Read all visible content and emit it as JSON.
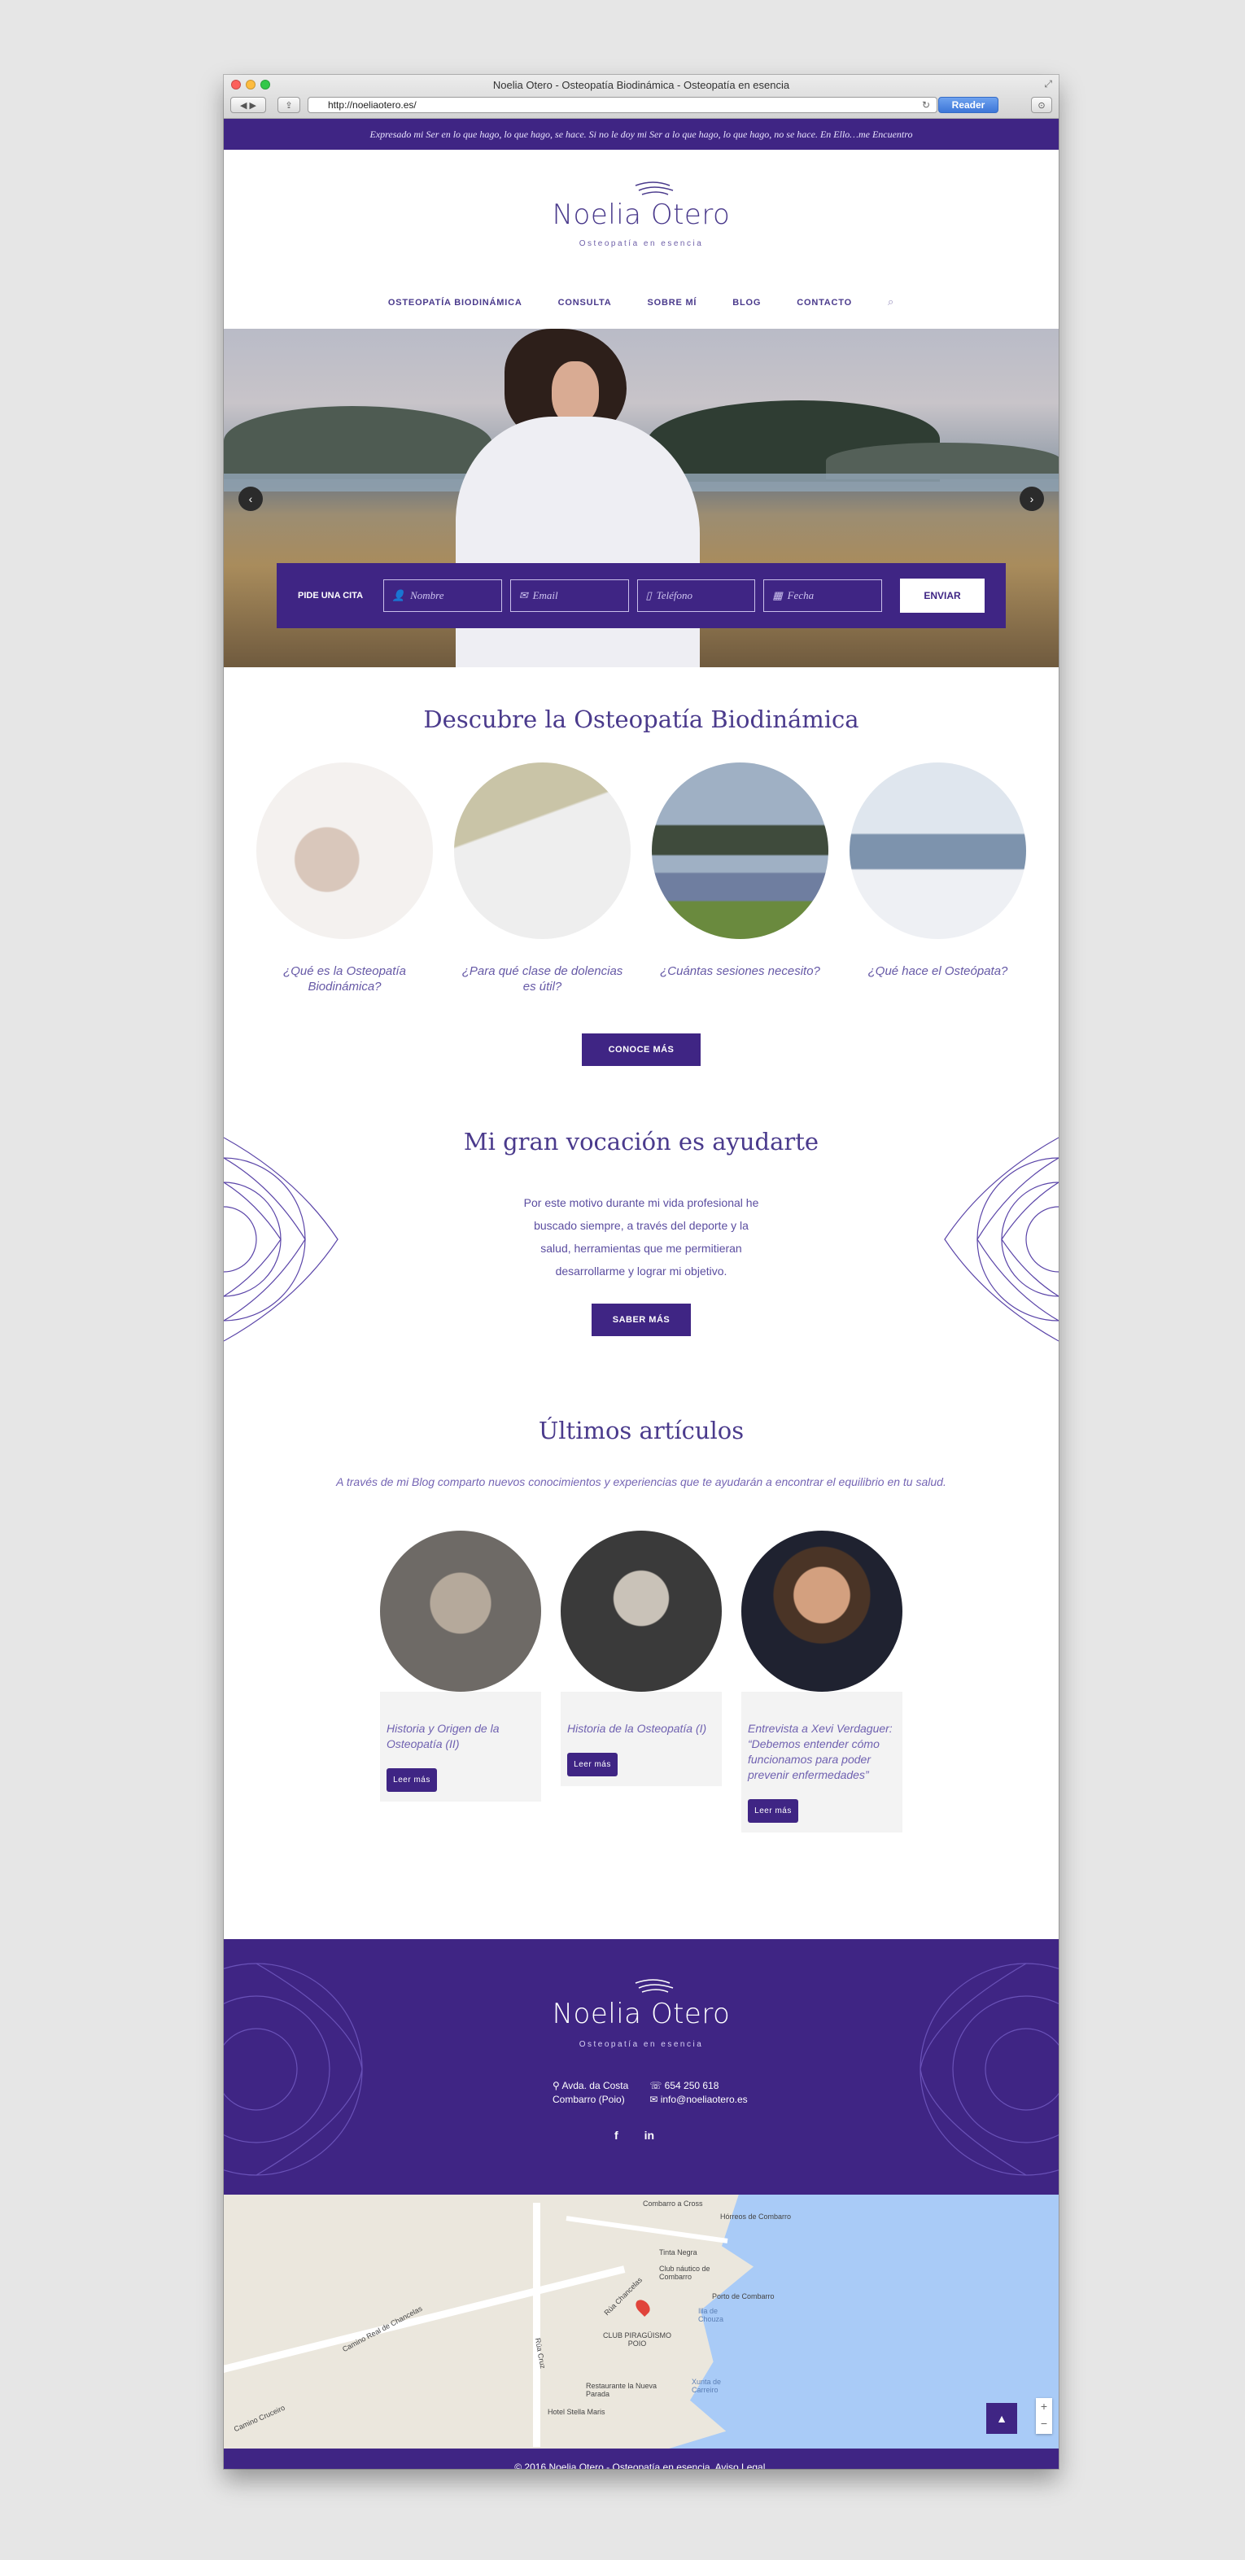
{
  "browser": {
    "title": "Noelia Otero - Osteopatía Biodinámica - Osteopatía en esencia",
    "url": "http://noeliaotero.es/",
    "reader": "Reader"
  },
  "topbar": {
    "quote": "Expresado mi Ser en lo que hago, lo que hago, se hace. Si no le doy mi Ser a lo que hago, lo que hago, no se hace. En Ello…me Encuentro"
  },
  "brand": {
    "name": "Noelia Otero",
    "tagline": "Osteopatía en esencia"
  },
  "nav": {
    "items": [
      {
        "label": "OSTEOPATÍA BIODINÁMICA"
      },
      {
        "label": "CONSULTA"
      },
      {
        "label": "SOBRE MÍ"
      },
      {
        "label": "BLOG"
      },
      {
        "label": "CONTACTO"
      }
    ]
  },
  "booking": {
    "label": "PIDE UNA CITA",
    "name_placeholder": "Nombre",
    "email_placeholder": "Email",
    "phone_placeholder": "Teléfono",
    "date_placeholder": "Fecha",
    "submit": "ENVIAR"
  },
  "discover": {
    "title": "Descubre la Osteopatía Biodinámica",
    "items": [
      {
        "caption": "¿Qué es la Osteopatía Biodinámica?"
      },
      {
        "caption": "¿Para qué clase de dolencias es útil?"
      },
      {
        "caption": "¿Cuántas sesiones necesito?"
      },
      {
        "caption": "¿Qué hace el Osteópata?"
      }
    ],
    "button": "CONOCE MÁS"
  },
  "vocation": {
    "title": "Mi gran vocación es ayudarte",
    "text": "Por este motivo durante mi vida profesional he buscado siempre, a través del deporte y la salud, herramientas que me permitieran desarrollarme y lograr mi objetivo.",
    "button": "SABER MÁS"
  },
  "articles": {
    "title": "Últimos artículos",
    "subtitle": "A través de mi Blog comparto nuevos conocimientos y experiencias que te ayudarán a encontrar el equilibrio en tu salud.",
    "items": [
      {
        "title": "Historia y Origen de la Osteopatía (II)",
        "button": "Leer más"
      },
      {
        "title": "Historia de la Osteopatía (I)",
        "button": "Leer más"
      },
      {
        "title": "Entrevista a Xevi Verdaguer: “Debemos entender cómo funcionamos para poder prevenir enfermedades”",
        "button": "Leer más"
      }
    ]
  },
  "footer": {
    "address_line1": "Avda. da Costa",
    "address_line2": "Combarro (Poio)",
    "phone": "654 250 618",
    "email": "info@noeliaotero.es",
    "copyright": "© 2016 Noelia Otero - Osteopatía en esencia. Aviso Legal."
  },
  "map": {
    "labels": [
      "Combarro a Cross",
      "Hórreos de Combarro",
      "Tinta Negra",
      "Club náutico de Combarro",
      "Porto de Combarro",
      "Illa de Chouza",
      "CLUB PIRAGÜISMO POIO",
      "Restaurante la Nueva Parada",
      "Hotel Stella Maris",
      "Camino Real de Chancelas",
      "Rúa Chancelas",
      "Rúa Cruz",
      "Camino Cruceiro",
      "Xunta de Carreiro"
    ],
    "zoom_in": "+",
    "zoom_out": "−"
  },
  "colors": {
    "brand_purple": "#3f2584",
    "text_purple": "#4a3a8c",
    "map_sea": "#a9cbf7"
  },
  "icons": [
    "search-icon",
    "user-icon",
    "envelope-icon",
    "phone-icon",
    "calendar-icon",
    "map-marker-icon",
    "facebook-icon",
    "linkedin-icon",
    "chevron-left-icon",
    "chevron-right-icon",
    "arrow-up-icon"
  ]
}
